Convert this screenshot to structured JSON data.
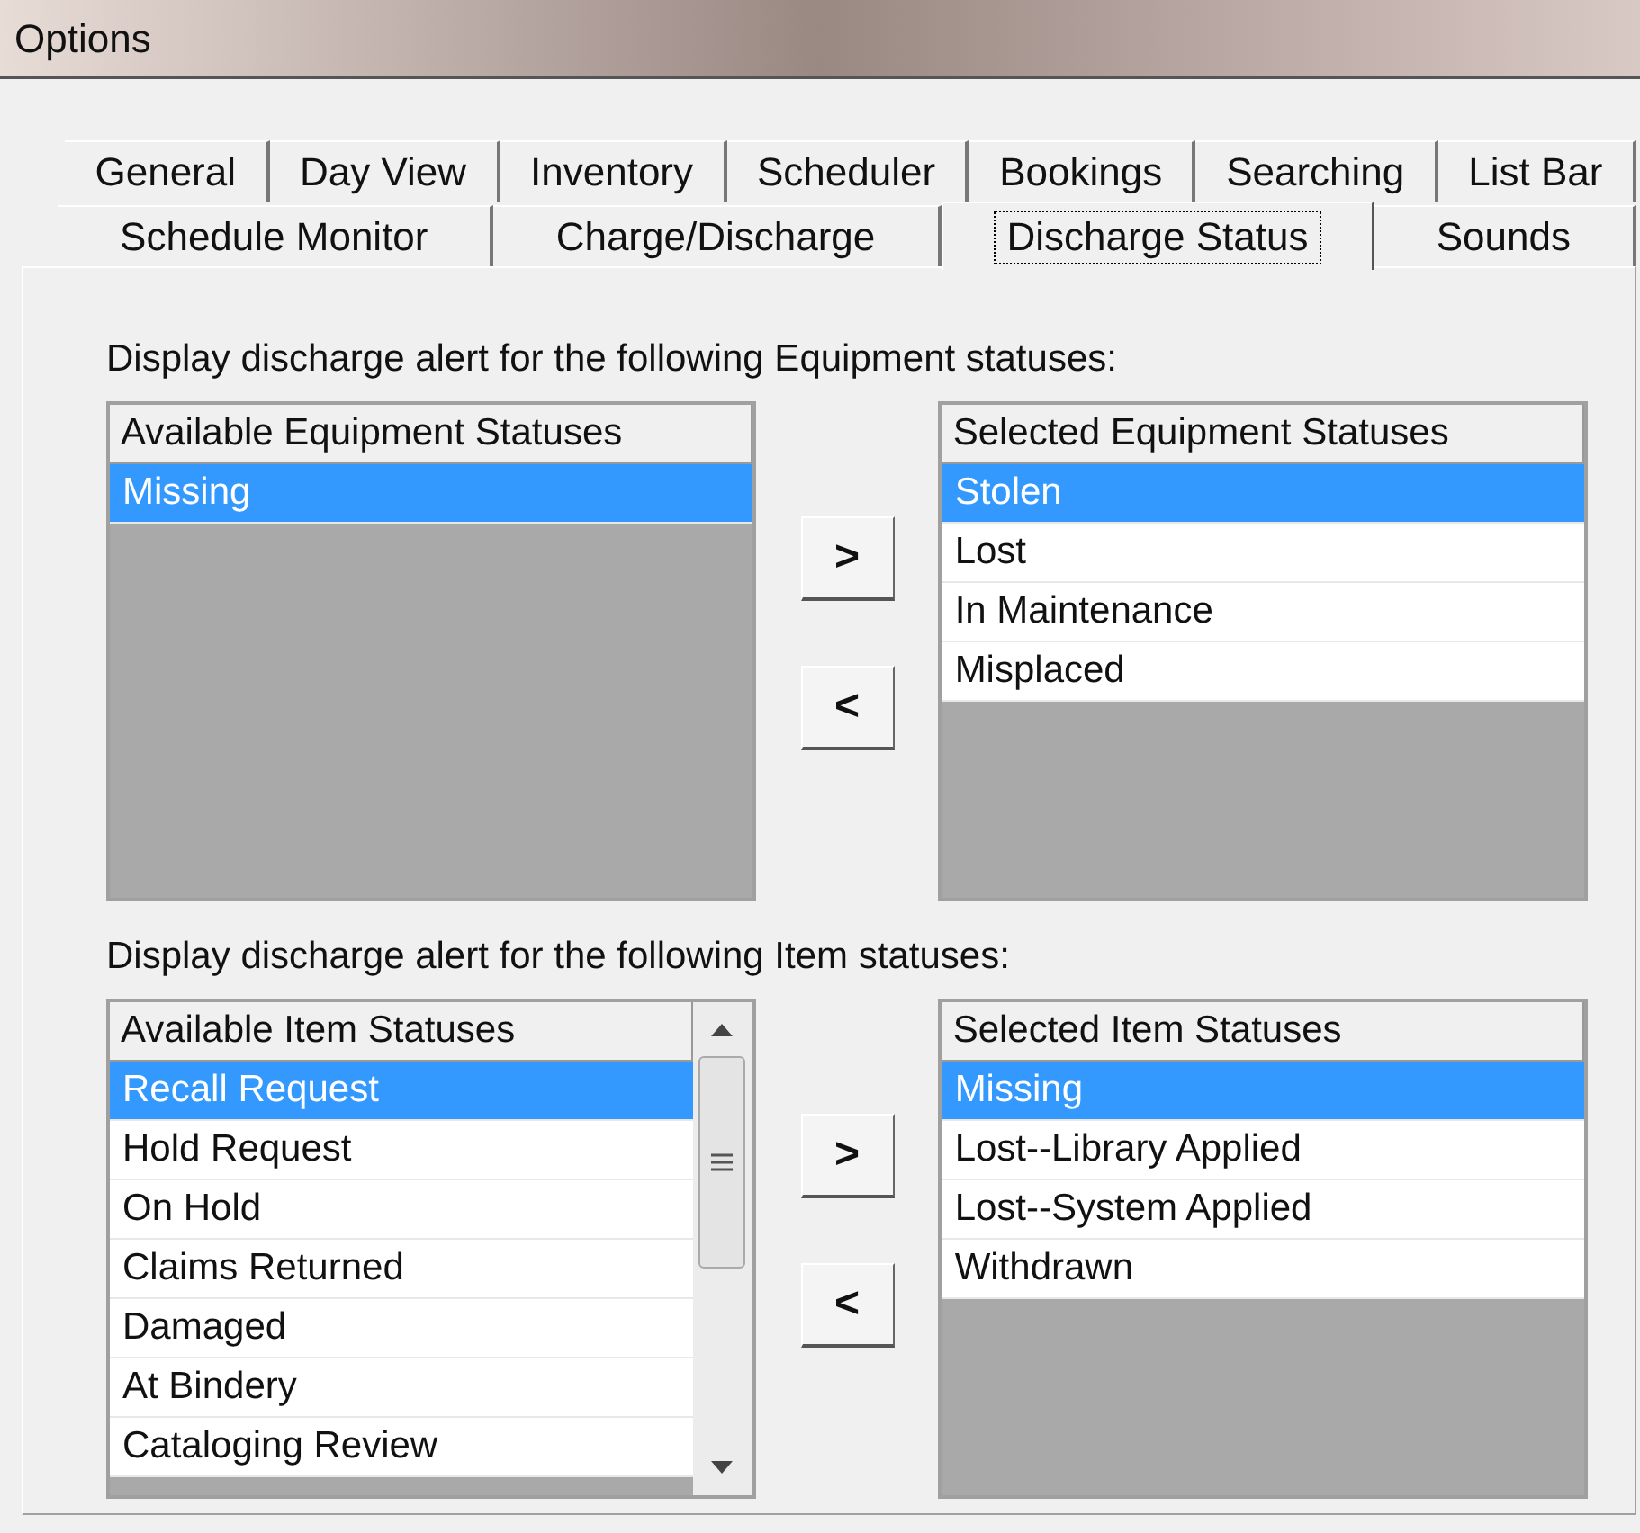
{
  "window": {
    "title": "Options"
  },
  "tab_rows": [
    [
      {
        "label": "General",
        "selected": false
      },
      {
        "label": "Day View",
        "selected": false
      },
      {
        "label": "Inventory",
        "selected": false
      },
      {
        "label": "Scheduler",
        "selected": false
      },
      {
        "label": "Bookings",
        "selected": false
      },
      {
        "label": "Searching",
        "selected": false
      },
      {
        "label": "List Bar",
        "selected": false
      }
    ],
    [
      {
        "label": "Schedule Monitor",
        "selected": false
      },
      {
        "label": "Charge/Discharge",
        "selected": false
      },
      {
        "label": "Discharge Status",
        "selected": true
      },
      {
        "label": "Sounds",
        "selected": false
      }
    ]
  ],
  "sections": [
    {
      "label": "Display discharge alert for the following Equipment statuses:",
      "available": {
        "header": "Available Equipment Statuses",
        "scrollbar": false,
        "items": [
          {
            "label": "Missing",
            "selected": true
          }
        ]
      },
      "buttons": [
        ">",
        "<"
      ],
      "chosen": {
        "header": "Selected Equipment Statuses",
        "scrollbar": false,
        "items": [
          {
            "label": "Stolen",
            "selected": true
          },
          {
            "label": "Lost",
            "selected": false
          },
          {
            "label": "In Maintenance",
            "selected": false
          },
          {
            "label": "Misplaced",
            "selected": false
          }
        ]
      }
    },
    {
      "label": "Display discharge alert for the following Item statuses:",
      "available": {
        "header": "Available Item Statuses",
        "scrollbar": true,
        "items": [
          {
            "label": "Recall Request",
            "selected": true
          },
          {
            "label": "Hold Request",
            "selected": false
          },
          {
            "label": "On Hold",
            "selected": false
          },
          {
            "label": "Claims Returned",
            "selected": false
          },
          {
            "label": "Damaged",
            "selected": false
          },
          {
            "label": "At Bindery",
            "selected": false
          },
          {
            "label": "Cataloging Review",
            "selected": false
          }
        ]
      },
      "buttons": [
        ">",
        "<"
      ],
      "chosen": {
        "header": "Selected Item Statuses",
        "scrollbar": false,
        "items": [
          {
            "label": "Missing",
            "selected": true
          },
          {
            "label": "Lost--Library Applied",
            "selected": false
          },
          {
            "label": "Lost--System Applied",
            "selected": false
          },
          {
            "label": "Withdrawn",
            "selected": false
          }
        ]
      }
    }
  ]
}
